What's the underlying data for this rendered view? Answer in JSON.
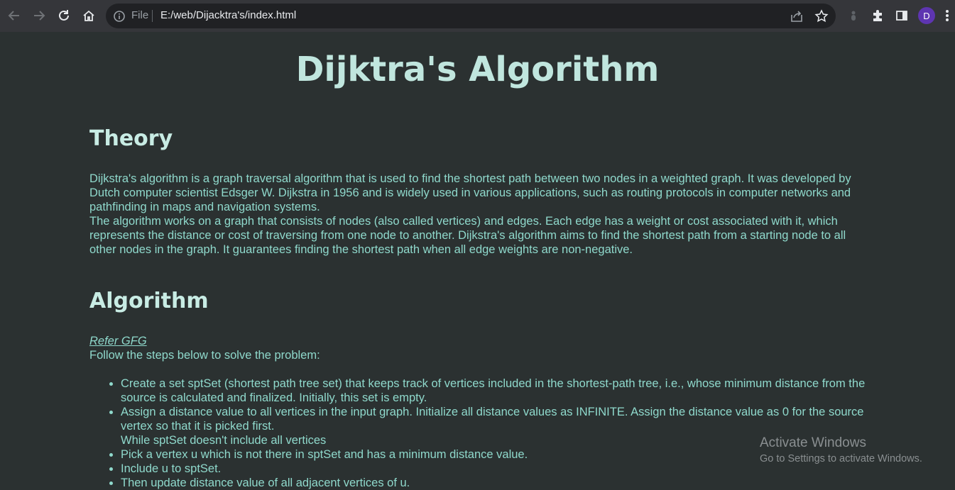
{
  "browser": {
    "file_label": "File",
    "url": "E:/web/Dijacktra's/index.html",
    "avatar_letter": "D"
  },
  "page": {
    "title": "Dijktra's Algorithm",
    "theory": {
      "heading": "Theory",
      "para1": "Dijkstra's algorithm is a graph traversal algorithm that is used to find the shortest path between two nodes in a weighted graph. It was developed by Dutch computer scientist Edsger W. Dijkstra in 1956 and is widely used in various applications, such as routing protocols in computer networks and pathfinding in maps and navigation systems.",
      "para2": "The algorithm works on a graph that consists of nodes (also called vertices) and edges. Each edge has a weight or cost associated with it, which represents the distance or cost of traversing from one node to another. Dijkstra's algorithm aims to find the shortest path from a starting node to all other nodes in the graph. It guarantees finding the shortest path when all edge weights are non-negative."
    },
    "algorithm": {
      "heading": "Algorithm",
      "refer_link": "Refer GFG",
      "intro": "Follow the steps below to solve the problem:",
      "steps": [
        "Create a set sptSet (shortest path tree set) that keeps track of vertices included in the shortest-path tree, i.e., whose minimum distance from the source is calculated and finalized. Initially, this set is empty.",
        "Assign a distance value to all vertices in the input graph. Initialize all distance values as INFINITE. Assign the distance value as 0 for the source vertex so that it is picked first.",
        "While sptSet doesn't include all vertices",
        "Pick a vertex u which is not there in sptSet and has a minimum distance value.",
        "Include u to sptSet.",
        "Then update distance value of all adjacent vertices of u."
      ]
    }
  },
  "watermark": {
    "line1": "Activate Windows",
    "line2": "Go to Settings to activate Windows."
  },
  "colors": {
    "background": "#2b3131",
    "title": "#c0e6de",
    "text": "#8fd9cc",
    "toolbar": "#35363a",
    "omnibox": "#202124"
  }
}
